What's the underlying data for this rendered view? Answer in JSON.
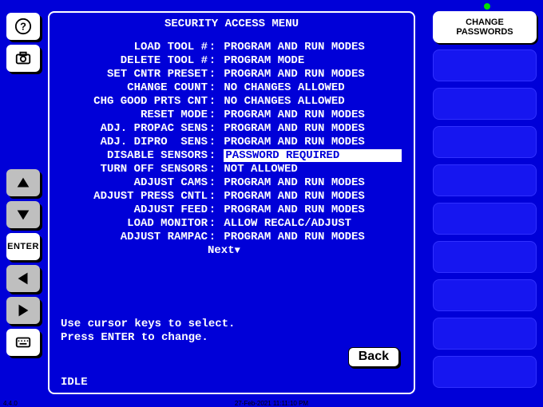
{
  "title": "SECURITY ACCESS MENU",
  "settings": [
    {
      "label": "LOAD TOOL #",
      "value": "PROGRAM AND RUN MODES",
      "selected": false
    },
    {
      "label": "DELETE TOOL #",
      "value": "PROGRAM MODE",
      "selected": false
    },
    {
      "label": "SET CNTR PRESET",
      "value": "PROGRAM AND RUN MODES",
      "selected": false
    },
    {
      "label": "CHANGE COUNT",
      "value": "NO CHANGES ALLOWED",
      "selected": false
    },
    {
      "label": "CHG GOOD PRTS CNT",
      "value": "NO CHANGES ALLOWED",
      "selected": false
    },
    {
      "label": "RESET MODE",
      "value": "PROGRAM AND RUN MODES",
      "selected": false
    },
    {
      "label": "ADJ. PROPAC SENS",
      "value": "PROGRAM AND RUN MODES",
      "selected": false
    },
    {
      "label": "ADJ. DIPRO  SENS",
      "value": "PROGRAM AND RUN MODES",
      "selected": false
    },
    {
      "label": "DISABLE SENSORS",
      "value": "PASSWORD REQUIRED",
      "selected": true
    },
    {
      "label": "TURN OFF SENSORS",
      "value": "NOT ALLOWED",
      "selected": false
    },
    {
      "label": "ADJUST CAMS",
      "value": "PROGRAM AND RUN MODES",
      "selected": false
    },
    {
      "label": "ADJUST PRESS CNTL",
      "value": "PROGRAM AND RUN MODES",
      "selected": false
    },
    {
      "label": "ADJUST FEED",
      "value": "PROGRAM AND RUN MODES",
      "selected": false
    },
    {
      "label": "LOAD MONITOR",
      "value": "ALLOW RECALC/ADJUST",
      "selected": false
    },
    {
      "label": "ADJUST RAMPAC",
      "value": "PROGRAM AND RUN MODES",
      "selected": false
    }
  ],
  "next": "Next",
  "help1": "Use cursor keys to select.",
  "help2": "Press ENTER to change.",
  "back": "Back",
  "status": "IDLE",
  "enter": "ENTER",
  "softkeys": {
    "change_passwords_l1": "CHANGE",
    "change_passwords_l2": "PASSWORDS"
  },
  "version": "4.4.0",
  "timestamp": "27-Feb-2021 11:11:10 PM"
}
